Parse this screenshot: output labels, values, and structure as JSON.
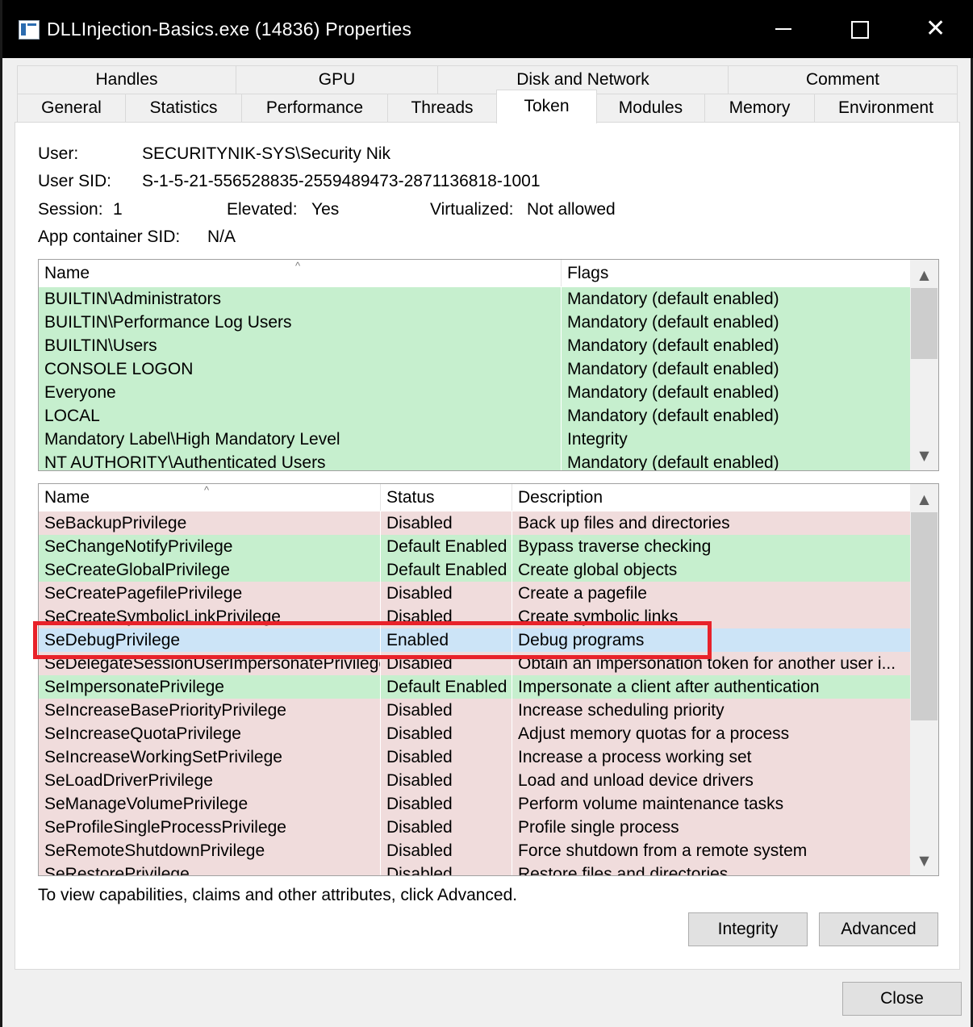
{
  "window": {
    "title": "DLLInjection-Basics.exe (14836) Properties",
    "icon": "app-window-icon",
    "controls": {
      "minimize": "minimize-icon",
      "maximize": "maximize-icon",
      "close": "close-icon",
      "close_glyph": "✕"
    }
  },
  "tabs": {
    "row1": [
      "Handles",
      "GPU",
      "Disk and Network",
      "Comment"
    ],
    "row2": [
      "General",
      "Statistics",
      "Performance",
      "Threads",
      "Token",
      "Modules",
      "Memory",
      "Environment"
    ],
    "active": "Token"
  },
  "token": {
    "user_label": "User:",
    "user_value": "SECURITYNIK-SYS\\Security Nik",
    "sid_label": "User SID:",
    "sid_value": "S-1-5-21-556528835-2559489473-2871136818-1001",
    "session_label": "Session:",
    "session_value": "1",
    "elevated_label": "Elevated:",
    "elevated_value": "Yes",
    "virtualized_label": "Virtualized:",
    "virtualized_value": "Not allowed",
    "appcontainer_label": "App container SID:",
    "appcontainer_value": "N/A"
  },
  "groups": {
    "columns": [
      "Name",
      "Flags"
    ],
    "sort_glyph": "^",
    "rows": [
      {
        "name": "BUILTIN\\Administrators",
        "flags": "Mandatory (default enabled)"
      },
      {
        "name": "BUILTIN\\Performance Log Users",
        "flags": "Mandatory (default enabled)"
      },
      {
        "name": "BUILTIN\\Users",
        "flags": "Mandatory (default enabled)"
      },
      {
        "name": "CONSOLE LOGON",
        "flags": "Mandatory (default enabled)"
      },
      {
        "name": "Everyone",
        "flags": "Mandatory (default enabled)"
      },
      {
        "name": "LOCAL",
        "flags": "Mandatory (default enabled)"
      },
      {
        "name": "Mandatory Label\\High Mandatory Level",
        "flags": "Integrity"
      },
      {
        "name": "NT AUTHORITY\\Authenticated Users",
        "flags": "Mandatory (default enabled)"
      }
    ]
  },
  "privileges": {
    "columns": [
      "Name",
      "Status",
      "Description"
    ],
    "sort_glyph": "^",
    "rows": [
      {
        "name": "SeBackupPrivilege",
        "status": "Disabled",
        "description": "Back up files and directories",
        "color": "pink"
      },
      {
        "name": "SeChangeNotifyPrivilege",
        "status": "Default Enabled",
        "description": "Bypass traverse checking",
        "color": "green"
      },
      {
        "name": "SeCreateGlobalPrivilege",
        "status": "Default Enabled",
        "description": "Create global objects",
        "color": "green"
      },
      {
        "name": "SeCreatePagefilePrivilege",
        "status": "Disabled",
        "description": "Create a pagefile",
        "color": "pink"
      },
      {
        "name": "SeCreateSymbolicLinkPrivilege",
        "status": "Disabled",
        "description": "Create symbolic links",
        "color": "pink"
      },
      {
        "name": "SeDebugPrivilege",
        "status": "Enabled",
        "description": "Debug programs",
        "color": "blue"
      },
      {
        "name": "SeDelegateSessionUserImpersonatePrivilege",
        "status": "Disabled",
        "description": "Obtain an impersonation token for another user i...",
        "color": "pink"
      },
      {
        "name": "SeImpersonatePrivilege",
        "status": "Default Enabled",
        "description": "Impersonate a client after authentication",
        "color": "green"
      },
      {
        "name": "SeIncreaseBasePriorityPrivilege",
        "status": "Disabled",
        "description": "Increase scheduling priority",
        "color": "pink"
      },
      {
        "name": "SeIncreaseQuotaPrivilege",
        "status": "Disabled",
        "description": "Adjust memory quotas for a process",
        "color": "pink"
      },
      {
        "name": "SeIncreaseWorkingSetPrivilege",
        "status": "Disabled",
        "description": "Increase a process working set",
        "color": "pink"
      },
      {
        "name": "SeLoadDriverPrivilege",
        "status": "Disabled",
        "description": "Load and unload device drivers",
        "color": "pink"
      },
      {
        "name": "SeManageVolumePrivilege",
        "status": "Disabled",
        "description": "Perform volume maintenance tasks",
        "color": "pink"
      },
      {
        "name": "SeProfileSingleProcessPrivilege",
        "status": "Disabled",
        "description": "Profile single process",
        "color": "pink"
      },
      {
        "name": "SeRemoteShutdownPrivilege",
        "status": "Disabled",
        "description": "Force shutdown from a remote system",
        "color": "pink"
      },
      {
        "name": "SeRestorePrivilege",
        "status": "Disabled",
        "description": "Restore files and directories",
        "color": "pink"
      }
    ]
  },
  "scroll": {
    "up": "▲",
    "down": "▼",
    "up_icon": "scroll-up-icon",
    "down_icon": "scroll-down-icon"
  },
  "footer": {
    "hint": "To view capabilities, claims and other attributes, click Advanced.",
    "integrity_button": "Integrity",
    "advanced_button": "Advanced",
    "close_button": "Close"
  },
  "colors": {
    "green_row": "#c6efce",
    "pink_row": "#f0dcdc",
    "selected_row": "#cce4f7",
    "highlight_box": "#e8222a"
  }
}
